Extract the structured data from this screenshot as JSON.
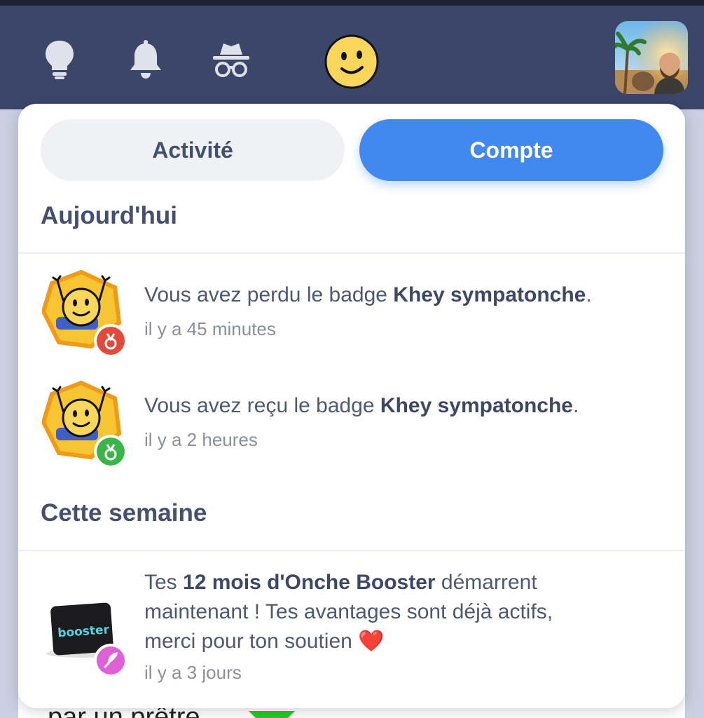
{
  "header": {
    "icons": [
      "lightbulb-icon",
      "bell-icon",
      "incognito-icon",
      "smiley-logo-icon"
    ],
    "avatar_alt": "user-avatar"
  },
  "tabs": {
    "activity": "Activité",
    "account": "Compte"
  },
  "sections": {
    "today": "Aujourd'hui",
    "this_week": "Cette semaine"
  },
  "notifications": [
    {
      "prefix": "Vous avez perdu le badge ",
      "bold": "Khey sympatonche",
      "suffix": ".",
      "time": "il y a 45 minutes",
      "status_color": "#e24a3b"
    },
    {
      "prefix": "Vous avez reçu le badge ",
      "bold": "Khey sympatonche",
      "suffix": ".",
      "time": "il y a 2 heures",
      "status_color": "#3bb54a"
    },
    {
      "prefix": "Tes ",
      "bold": "12 mois d'Onche Booster",
      "line1_rest": " démarrent",
      "line2": "maintenant ! Tes avantages sont déjà actifs,",
      "line3": "merci pour ton soutien ❤️",
      "time": "il y a 3 jours",
      "card_text": "booster",
      "status_color": "#e060d8"
    }
  ],
  "underlying": {
    "text": "par un prêtre"
  },
  "colors": {
    "navbar": "#3b4669",
    "accent": "#4189f0",
    "heading": "#45506e"
  }
}
